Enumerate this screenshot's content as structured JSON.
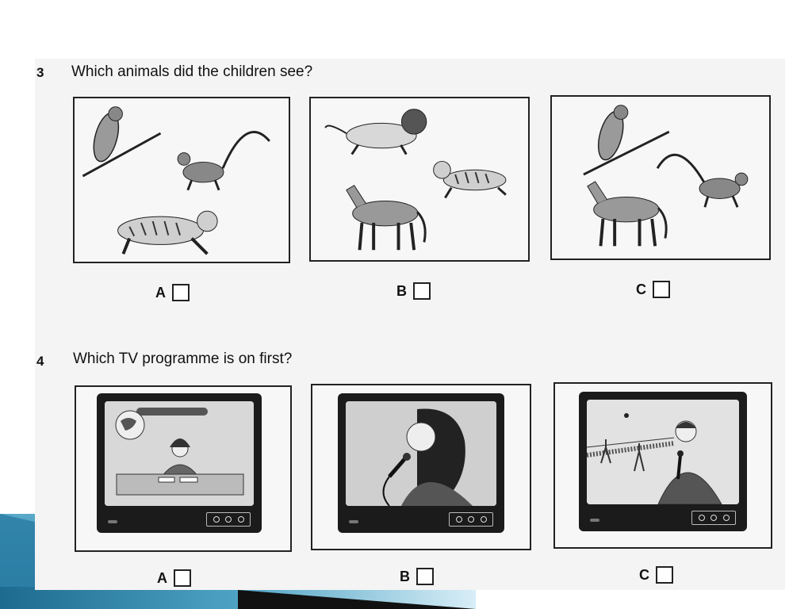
{
  "questions": [
    {
      "number": "3",
      "text": "Which animals did the children see?",
      "options": [
        {
          "label": "A",
          "animals": [
            "parrot",
            "monkey",
            "tiger"
          ]
        },
        {
          "label": "B",
          "animals": [
            "lion",
            "tiger",
            "horse"
          ]
        },
        {
          "label": "C",
          "animals": [
            "parrot",
            "monkey",
            "horse"
          ]
        }
      ]
    },
    {
      "number": "4",
      "text": "Which TV programme is on first?",
      "options": [
        {
          "label": "A",
          "programme": "news-reader"
        },
        {
          "label": "B",
          "programme": "singer"
        },
        {
          "label": "C",
          "programme": "tennis-reporter"
        }
      ]
    }
  ],
  "colors": {
    "border": "#222222",
    "sheet": "#f4f4f4",
    "tv_body": "#1b1b1b",
    "accent": "#2c7ea6"
  }
}
